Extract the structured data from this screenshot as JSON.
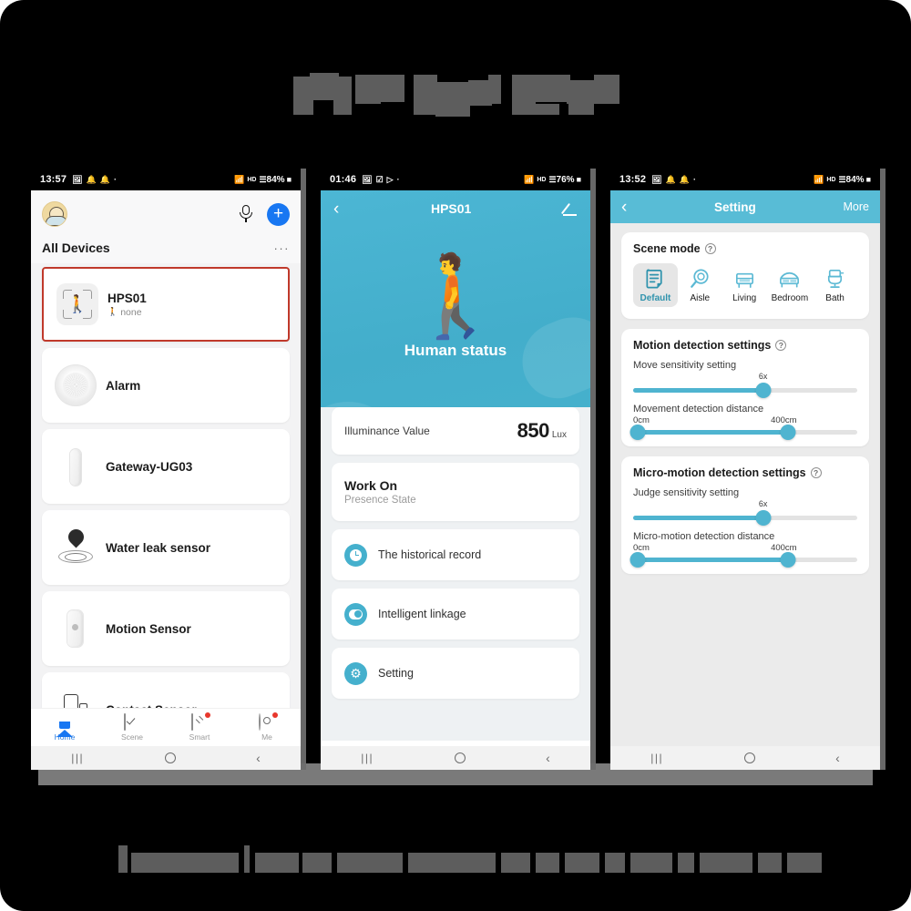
{
  "page": {
    "title_redacted": "APP Page Show",
    "caption_redacted": "caption text hidden"
  },
  "phone1": {
    "statusbar": {
      "time": "13:57",
      "left_icons": [
        "image-icon",
        "bell-icon",
        "bell-icon",
        "dot-icon"
      ],
      "right_icons": [
        "wifi-icon",
        "hd-icon",
        "signal-icon"
      ],
      "battery": "84%"
    },
    "header": {
      "avatar": "user-avatar",
      "mic_icon": "microphone-icon",
      "add_label": "+",
      "page_title": "All Devices",
      "more_label": "···"
    },
    "devices": [
      {
        "name": "HPS01",
        "sub": "none",
        "icon": "human-presence-sensor-icon",
        "selected": true
      },
      {
        "name": "Alarm",
        "sub": "",
        "icon": "alarm-siren-icon",
        "selected": false
      },
      {
        "name": "Gateway-UG03",
        "sub": "",
        "icon": "gateway-dongle-icon",
        "selected": false
      },
      {
        "name": "Water leak sensor",
        "sub": "",
        "icon": "water-drop-icon",
        "selected": false
      },
      {
        "name": "Motion Sensor",
        "sub": "",
        "icon": "motion-sensor-icon",
        "selected": false
      },
      {
        "name": "Contact Sensor",
        "sub": "",
        "icon": "contact-sensor-icon",
        "selected": false
      }
    ],
    "nav": [
      {
        "label": "Home",
        "icon": "home-icon",
        "active": true,
        "badge": false
      },
      {
        "label": "Scene",
        "icon": "checkbox-icon",
        "active": false,
        "badge": false
      },
      {
        "label": "Smart",
        "icon": "smart-icon",
        "active": false,
        "badge": true
      },
      {
        "label": "Me",
        "icon": "profile-icon",
        "active": false,
        "badge": true
      }
    ],
    "android_nav": {
      "recent": "|||",
      "home": "home-circle-icon",
      "back": "‹"
    }
  },
  "phone2": {
    "statusbar": {
      "time": "01:46",
      "battery": "76%"
    },
    "header": {
      "back_icon": "back-chevron-icon",
      "title": "HPS01",
      "edit_icon": "edit-pencil-icon",
      "status_icon": "walking-human-icon",
      "status_label": "Human status"
    },
    "illuminance": {
      "label": "Illuminance Value",
      "value": "850",
      "unit": "Lux"
    },
    "work": {
      "title": "Work On",
      "sub": "Presence State"
    },
    "menu": [
      {
        "label": "The historical record",
        "icon": "clock-icon"
      },
      {
        "label": "Intelligent linkage",
        "icon": "toggle-icon"
      },
      {
        "label": "Setting",
        "icon": "gear-icon"
      }
    ],
    "android_nav": {
      "recent": "|||",
      "home": "home-circle-icon",
      "back": "‹"
    }
  },
  "phone3": {
    "statusbar": {
      "time": "13:52",
      "battery": "84%"
    },
    "header": {
      "back_icon": "back-chevron-icon",
      "title": "Setting",
      "more_label": "More"
    },
    "scene_mode": {
      "title": "Scene mode",
      "help": "?",
      "options": [
        {
          "label": "Default",
          "icon": "document-icon",
          "active": true
        },
        {
          "label": "Aisle",
          "icon": "magnifier-icon",
          "active": false
        },
        {
          "label": "Living",
          "icon": "sofa-icon",
          "active": false
        },
        {
          "label": "Bedroom",
          "icon": "bed-icon",
          "active": false
        },
        {
          "label": "Bath",
          "icon": "toilet-icon",
          "active": false
        }
      ]
    },
    "motion": {
      "title": "Motion detection settings",
      "help": "?",
      "sensitivity": {
        "label": "Move sensitivity setting",
        "value": "6x",
        "percent": 58
      },
      "distance": {
        "label": "Movement detection distance",
        "min_label": "0cm",
        "max_label": "400cm",
        "start_percent": 2,
        "end_percent": 69
      }
    },
    "micro": {
      "title": "Micro-motion detection settings",
      "help": "?",
      "sensitivity": {
        "label": "Judge sensitivity setting",
        "value": "6x",
        "percent": 58
      },
      "distance": {
        "label": "Micro-motion detection distance",
        "min_label": "0cm",
        "max_label": "400cm",
        "start_percent": 2,
        "end_percent": 69
      }
    },
    "android_nav": {
      "recent": "|||",
      "home": "home-circle-icon",
      "back": "‹"
    }
  },
  "colors": {
    "accent_blue": "#4fb4d0",
    "header_blue": "#58bcd6",
    "add_button": "#1877f2",
    "selected_outline": "#c0392b",
    "badge": "#e8372c"
  }
}
